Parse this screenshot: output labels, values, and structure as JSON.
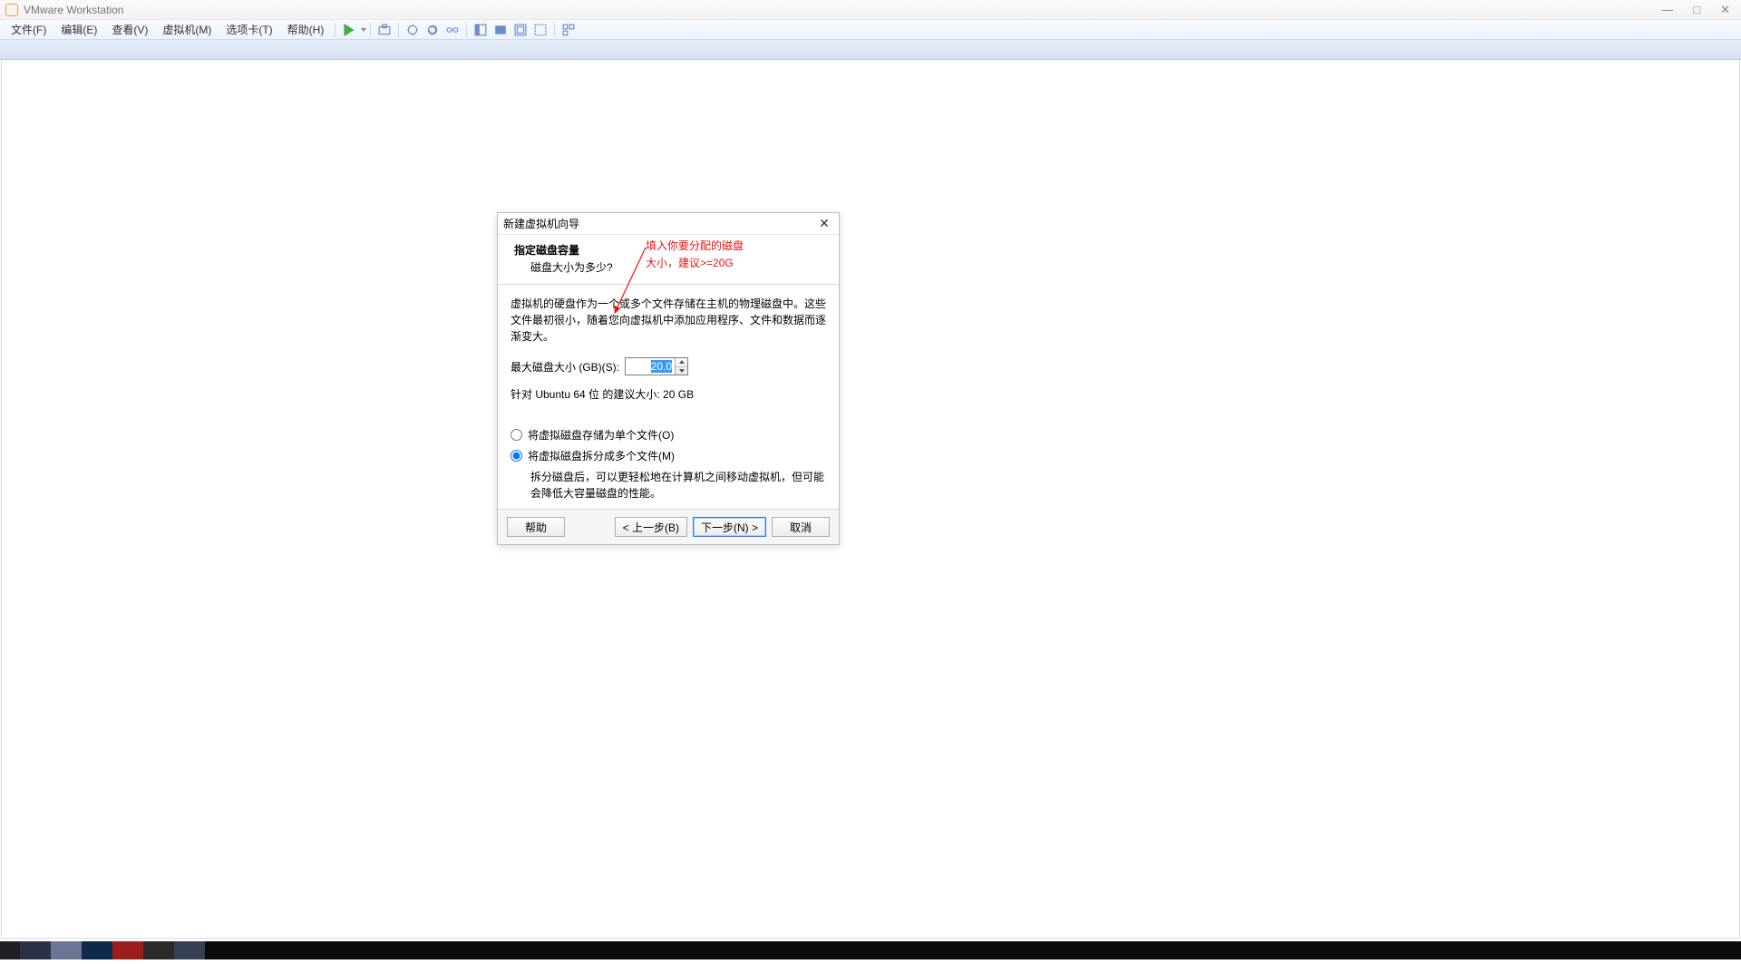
{
  "window": {
    "title": "VMware Workstation"
  },
  "menubar": {
    "file": "文件(F)",
    "edit": "编辑(E)",
    "view": "查看(V)",
    "vm": "虚拟机(M)",
    "tabs": "选项卡(T)",
    "help": "帮助(H)"
  },
  "dialog": {
    "title": "新建虚拟机向导",
    "header_bold": "指定磁盘容量",
    "header_sub": "磁盘大小为多少?",
    "desc": "虚拟机的硬盘作为一个或多个文件存储在主机的物理磁盘中。这些文件最初很小，随着您向虚拟机中添加应用程序、文件和数据而逐渐变大。",
    "size_label": "最大磁盘大小 (GB)(S):",
    "size_value": "20.0",
    "recommend": "针对 Ubuntu 64 位 的建议大小: 20 GB",
    "radio_single": "将虚拟磁盘存储为单个文件(O)",
    "radio_split": "将虚拟磁盘拆分成多个文件(M)",
    "split_desc": "拆分磁盘后，可以更轻松地在计算机之间移动虚拟机，但可能会降低大容量磁盘的性能。",
    "btn_help": "帮助",
    "btn_back": "< 上一步(B)",
    "btn_next": "下一步(N) >",
    "btn_cancel": "取消"
  },
  "annotation": {
    "line1": "填入你要分配的磁盘",
    "line2": "大小，建议>=20G"
  }
}
